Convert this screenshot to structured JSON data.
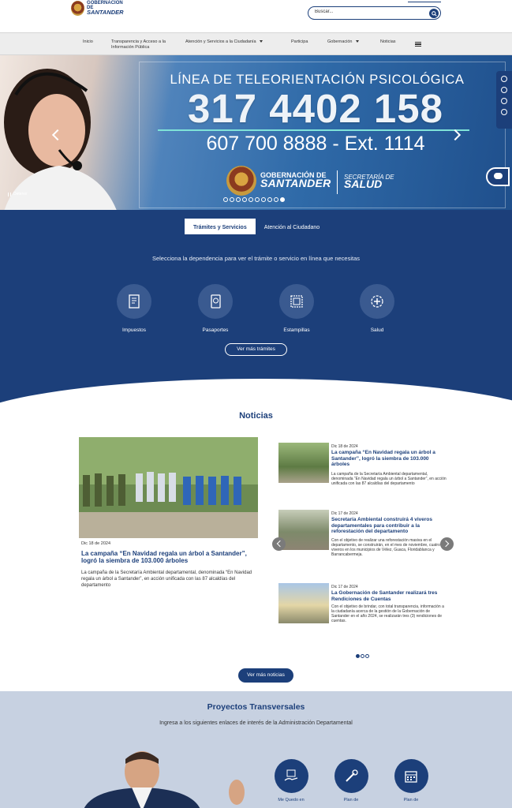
{
  "header": {
    "logo_line1": "GOBERNACIÓN DE",
    "logo_line2": "SANTANDER",
    "search_placeholder": "Buscar..."
  },
  "nav": {
    "items": [
      {
        "label": "Inicio",
        "dropdown": false
      },
      {
        "label": "Transparencia y Acceso a la Información Pública",
        "dropdown": false
      },
      {
        "label": "Atención y Servicios a la Ciudadanía",
        "dropdown": true
      },
      {
        "label": "Participa",
        "dropdown": false
      },
      {
        "label": "Gobernación",
        "dropdown": true
      },
      {
        "label": "Noticias",
        "dropdown": false
      }
    ],
    "menu_icon": "hamburger-icon"
  },
  "hero": {
    "title": "LÍNEA DE TELEORIENTACIÓN PSICOLÓGICA",
    "phone": "317 4402 158",
    "ext": "607 700 8888 - Ext. 1114",
    "gob_line1": "GOBERNACIÓN DE",
    "gob_line2": "SANTANDER",
    "sec_line1": "SECRETARÍA DE",
    "sec_line2": "SALUD",
    "pause_label": "Detener",
    "slide_count": 10,
    "active_slide": 10
  },
  "tramites": {
    "tabs": [
      "Trámites y Servicios",
      "Atención al Ciudadano"
    ],
    "active_tab": 0,
    "subtitle": "Selecciona la dependencia para ver el trámite o servicio en línea que necesitas",
    "items": [
      {
        "label": "Impuestos",
        "icon": "receipt-icon"
      },
      {
        "label": "Pasaportes",
        "icon": "passport-icon"
      },
      {
        "label": "Estampillas",
        "icon": "stamp-icon"
      },
      {
        "label": "Salud",
        "icon": "health-icon"
      }
    ],
    "more_button": "Ver más trámites"
  },
  "noticias": {
    "title": "Noticias",
    "main": {
      "date": "Dic 18 de 2024",
      "headline": "La campaña “En Navidad regala un árbol a Santander”, logró la siembra de 103.000 árboles",
      "body": "La campaña de la Secretaría Ambiental departamental, denominada “En Navidad regala un árbol a Santander”, en acción unificada con las 87 alcaldías del departamento"
    },
    "side": [
      {
        "date": "Dic 18 de 2024",
        "headline": "La campaña “En Navidad regala un árbol a Santander”, logró la siembra de 103.000 árboles",
        "body": "La campaña de la Secretaría Ambiental departamental, denominada “En Navidad regala un árbol a Santander”, en acción unificada con las 87 alcaldías del departamento"
      },
      {
        "date": "Dic 17 de 2024",
        "headline": "Secretaría Ambiental construirá 4 viveros departamentales para contribuir a la reforestación del departamento",
        "body": "Con el objetivo de realizar una reforestación masiva en el departamento, se construirán, en el mes de noviembre, cuatro (4) viveros en los municipios de Vélez, Guaca, Floridablanca y Barrancabermeja."
      },
      {
        "date": "Dic 17 de 2024",
        "headline": "La Gobernación de Santander realizará tres Rendiciones de Cuentas",
        "body": "Con el objetivo de brindar, con total transparencia, información a la ciudadanía acerca de la gestión de la Gobernación de Santander en el año 2024, se realizarán tres (3) rendiciones de cuentas."
      }
    ],
    "page_count": 3,
    "active_page": 1,
    "more_button": "Ver más noticias"
  },
  "proyectos": {
    "title": "Proyectos Transversales",
    "subtitle": "Ingresa a los siguientes enlaces de interés de la Administración Departamental",
    "items": [
      {
        "label": "Me Quedo en",
        "icon": "handshake-icon"
      },
      {
        "label": "Plan de",
        "icon": "tools-icon"
      },
      {
        "label": "Plan de",
        "icon": "calendar-icon"
      }
    ]
  },
  "colors": {
    "brand_blue": "#1c3f7a",
    "nav_bg": "#ededed",
    "proyectos_bg": "#c7d1e1"
  }
}
